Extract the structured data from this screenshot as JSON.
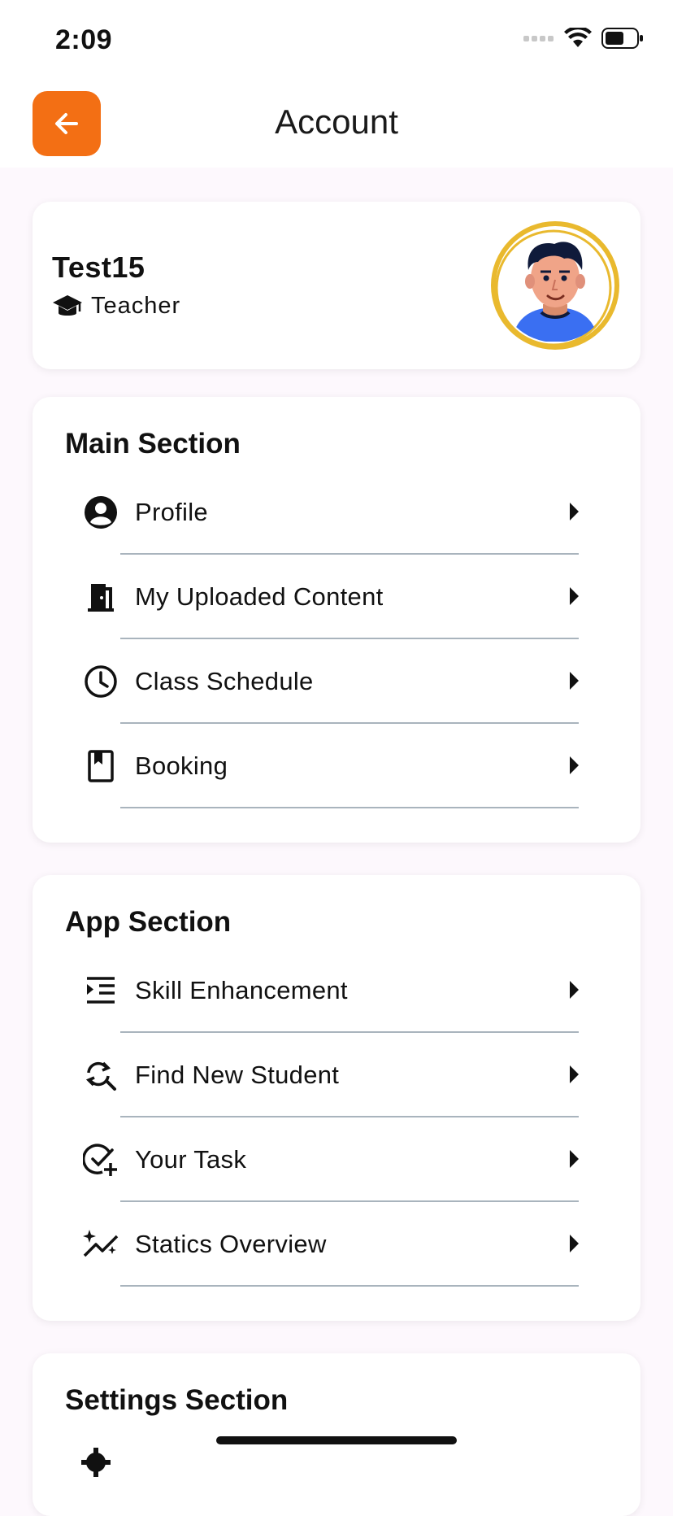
{
  "status_bar": {
    "time": "2:09"
  },
  "app_bar": {
    "title": "Account"
  },
  "profile": {
    "name": "Test15",
    "role": "Teacher"
  },
  "main_section": {
    "title": "Main Section",
    "items": [
      {
        "label": "Profile",
        "icon": "account-circle-icon"
      },
      {
        "label": "My Uploaded Content",
        "icon": "door-icon"
      },
      {
        "label": "Class Schedule",
        "icon": "clock-icon"
      },
      {
        "label": "Booking",
        "icon": "bookmark-book-icon"
      }
    ]
  },
  "app_section": {
    "title": "App Section",
    "items": [
      {
        "label": "Skill Enhancement",
        "icon": "indent-list-icon"
      },
      {
        "label": "Find New Student",
        "icon": "search-refresh-icon"
      },
      {
        "label": "Your Task",
        "icon": "check-plus-icon"
      },
      {
        "label": "Statics Overview",
        "icon": "sparkle-chart-icon"
      }
    ]
  },
  "settings_section": {
    "title": "Settings Section"
  },
  "colors": {
    "accent": "#f36f14",
    "divider": "#a9b4bd",
    "avatar_ring": "#e9b92e",
    "avatar_shirt": "#3a6ff2"
  }
}
